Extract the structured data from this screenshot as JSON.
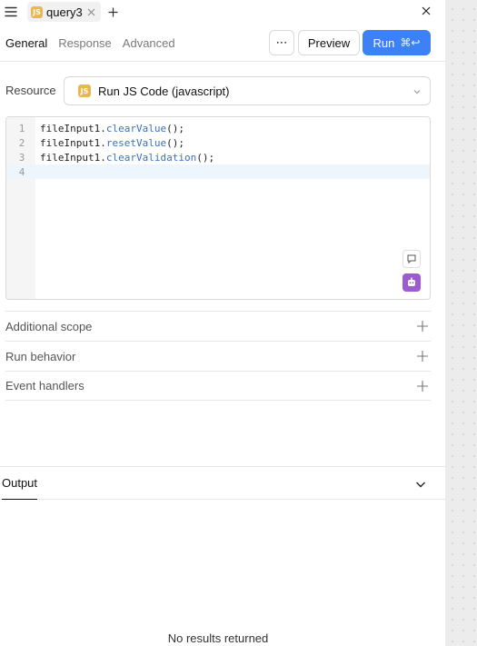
{
  "tabs": {
    "active": {
      "label": "query3",
      "badge": "JS"
    }
  },
  "subtabs": [
    "General",
    "Response",
    "Advanced"
  ],
  "actions": {
    "more_label": "⋯",
    "preview_label": "Preview",
    "run_label": "Run",
    "run_shortcut": "⌘↩"
  },
  "resource": {
    "label": "Resource",
    "badge": "JS",
    "value": "Run JS Code (javascript)"
  },
  "editor": {
    "lines": [
      {
        "no": "1",
        "object": "fileInput1",
        "method": "clearValue",
        "tail": "();"
      },
      {
        "no": "2",
        "object": "fileInput1",
        "method": "resetValue",
        "tail": "();"
      },
      {
        "no": "3",
        "object": "fileInput1",
        "method": "clearValidation",
        "tail": "();"
      },
      {
        "no": "4",
        "object": "",
        "method": "",
        "tail": ""
      }
    ],
    "current_line": 4
  },
  "sections": [
    "Additional scope",
    "Run behavior",
    "Event handlers"
  ],
  "output": {
    "tab_label": "Output",
    "empty_message": "No results returned"
  },
  "colors": {
    "accent": "#3c82f6",
    "js_badge": "#e9b64f",
    "ai_button": "#9d5bd2",
    "method_token": "#3b6fc2"
  }
}
